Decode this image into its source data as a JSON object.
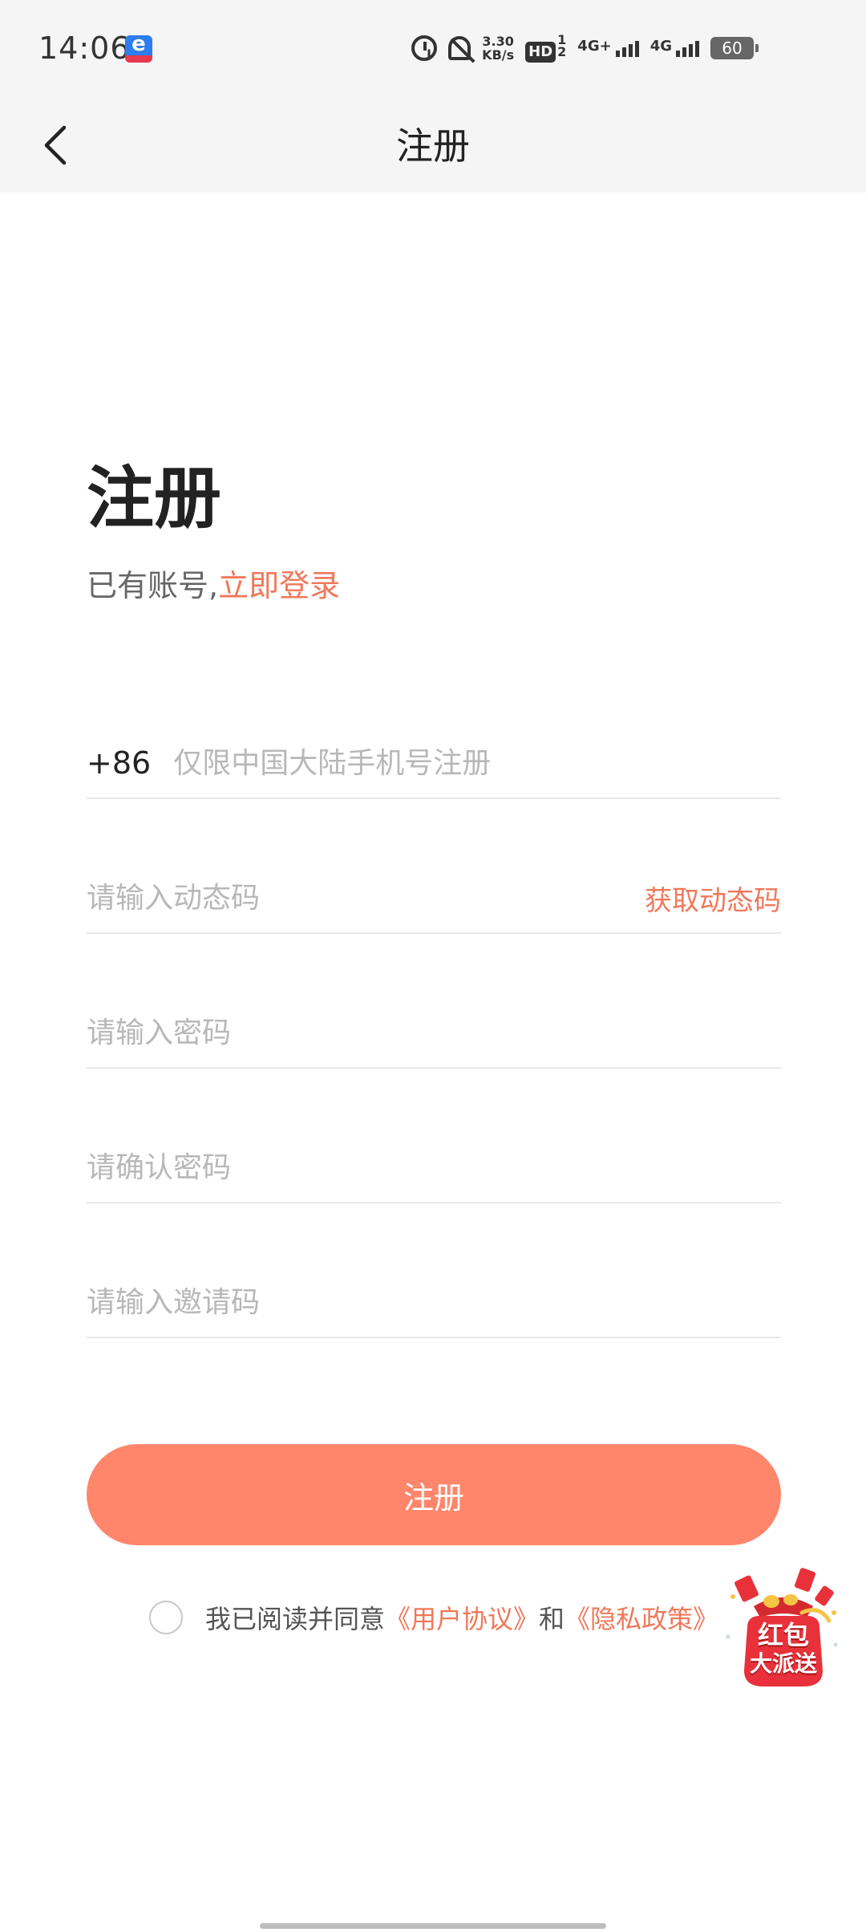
{
  "status_bar": {
    "time": "14:06",
    "net_speed_value": "3.30",
    "net_speed_unit": "KB/s",
    "hd_label": "HD",
    "hd_sub_top": "1",
    "hd_sub_bottom": "2",
    "signal1_label": "4G+",
    "signal2_label": "4G",
    "battery": "60",
    "icons": [
      "app-notification-icon",
      "alarm-icon",
      "bell-off-icon",
      "hd-icon",
      "signal-icon",
      "battery-icon"
    ]
  },
  "nav": {
    "back_icon": "chevron-left-icon",
    "title": "注册"
  },
  "heading": {
    "title": "注册",
    "has_account": "已有账号,",
    "login_link": "立即登录"
  },
  "form": {
    "country_code": "+86",
    "phone_placeholder": "仅限中国大陆手机号注册",
    "code_placeholder": "请输入动态码",
    "get_code_label": "获取动态码",
    "password_placeholder": "请输入密码",
    "confirm_placeholder": "请确认密码",
    "invite_placeholder": "请输入邀请码"
  },
  "submit_label": "注册",
  "agreement": {
    "prefix": "我已阅读并同意",
    "user_agreement": "《用户协议》",
    "and": "和",
    "privacy_policy": "《隐私政策》"
  },
  "promo": {
    "line1": "红包",
    "line2": "大派送"
  },
  "colors": {
    "accent": "#f0785a",
    "button": "#ff866b",
    "header_bg": "#f5f5f5"
  }
}
